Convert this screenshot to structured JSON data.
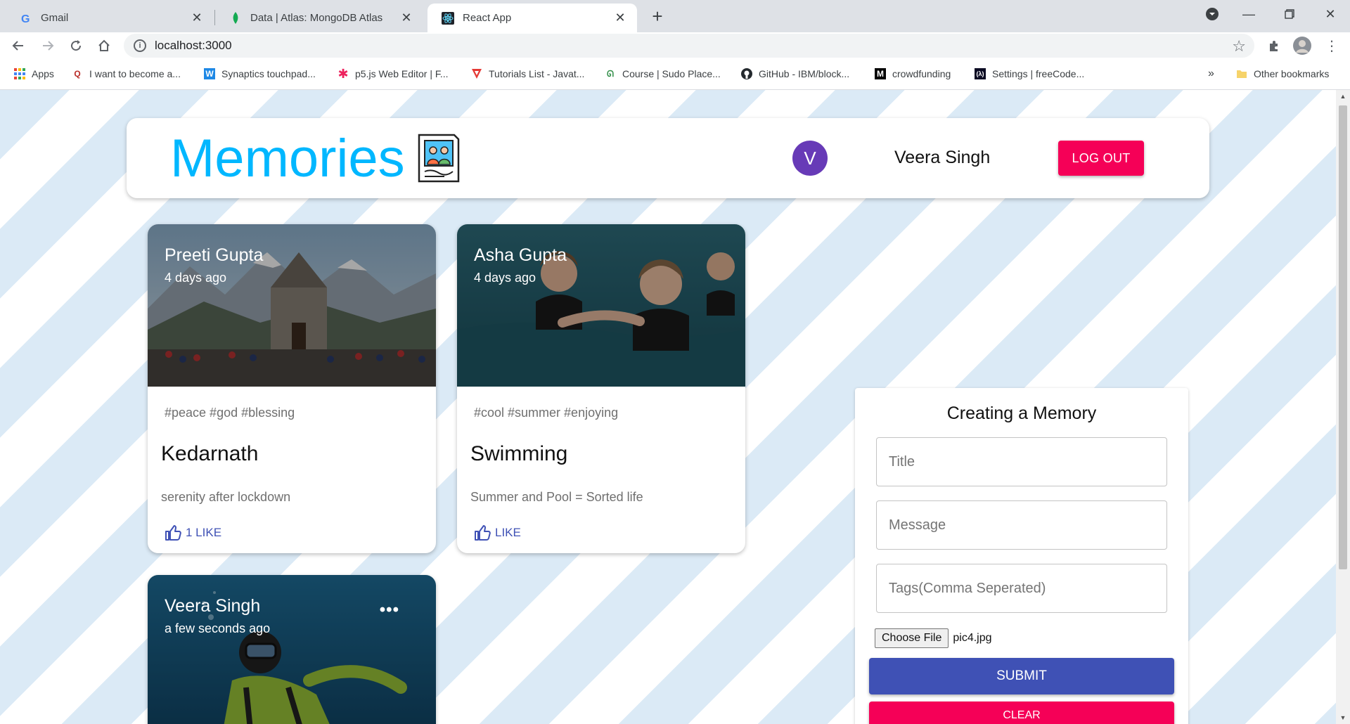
{
  "browser": {
    "tabs": [
      {
        "title": "Gmail",
        "icon": "google-g-icon",
        "active": false
      },
      {
        "title": "Data | Atlas: MongoDB Atlas",
        "icon": "mongodb-leaf-icon",
        "active": false
      },
      {
        "title": "React App",
        "icon": "react-icon",
        "active": true
      }
    ],
    "url": "localhost:3000",
    "bookmarks": [
      {
        "label": "Apps",
        "icon": "apps-grid-icon"
      },
      {
        "label": "I want to become a...",
        "icon": "quora-icon"
      },
      {
        "label": "Synaptics touchpad...",
        "icon": "w-icon"
      },
      {
        "label": "p5.js Web Editor | F...",
        "icon": "p5js-icon"
      },
      {
        "label": "Tutorials List - Javat...",
        "icon": "javatpoint-icon"
      },
      {
        "label": "Course | Sudo Place...",
        "icon": "geeksforgeeks-icon"
      },
      {
        "label": "GitHub - IBM/block...",
        "icon": "github-icon"
      },
      {
        "label": "crowdfunding",
        "icon": "medium-icon"
      },
      {
        "label": "Settings | freeCode...",
        "icon": "freecodecamp-icon"
      }
    ],
    "overflow_label": "»",
    "other_bookmarks": "Other bookmarks"
  },
  "app": {
    "brand": "Memories",
    "user": {
      "initial": "V",
      "name": "Veera Singh"
    },
    "logout_label": "LOG OUT"
  },
  "posts": [
    {
      "creator": "Preeti Gupta",
      "time": "4 days ago",
      "tags": "#peace #god #blessing",
      "title": "Kedarnath",
      "message": "serenity after lockdown",
      "like_label": "1 LIKE"
    },
    {
      "creator": "Asha Gupta",
      "time": "4 days ago",
      "tags": "#cool #summer #enjoying",
      "title": "Swimming",
      "message": "Summer and Pool = Sorted life",
      "like_label": "LIKE"
    },
    {
      "creator": "Veera Singh",
      "time": "a few seconds ago",
      "more_label": "•••"
    }
  ],
  "form": {
    "heading": "Creating a Memory",
    "title_placeholder": "Title",
    "message_placeholder": "Message",
    "tags_placeholder": "Tags(Comma Seperated)",
    "choose_file_label": "Choose File",
    "file_name": "pic4.jpg",
    "submit_label": "SUBMIT",
    "clear_label": "CLEAR"
  },
  "colors": {
    "brand": "#00b7ff",
    "avatar": "#673ab7",
    "secondary": "#f50057",
    "primary": "#3f51b5"
  }
}
